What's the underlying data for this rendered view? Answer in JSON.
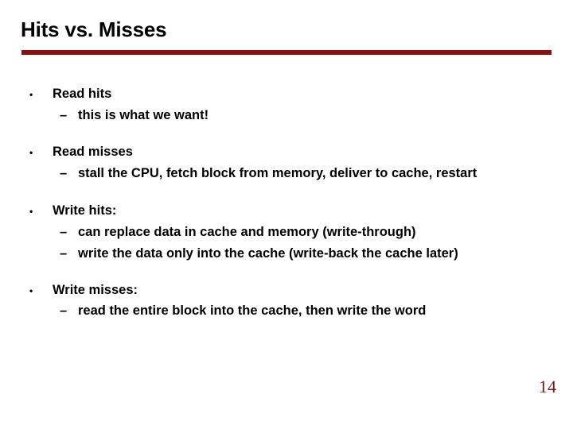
{
  "slide": {
    "title": "Hits vs. Misses",
    "accent_color": "#8b1010",
    "page_number": "14",
    "bullet_glyph": "•",
    "sub_glyph": "–",
    "items": [
      {
        "label": "Read hits",
        "subitems": [
          "this is what we want!"
        ]
      },
      {
        "label": "Read misses",
        "subitems": [
          "stall the CPU, fetch block from memory, deliver to cache, restart"
        ]
      },
      {
        "label": "Write hits:",
        "subitems": [
          "can replace data in cache and memory (write-through)",
          "write the data only into the cache (write-back the cache later)"
        ]
      },
      {
        "label": "Write misses:",
        "subitems": [
          "read the entire block into the cache, then write the word"
        ]
      }
    ]
  }
}
